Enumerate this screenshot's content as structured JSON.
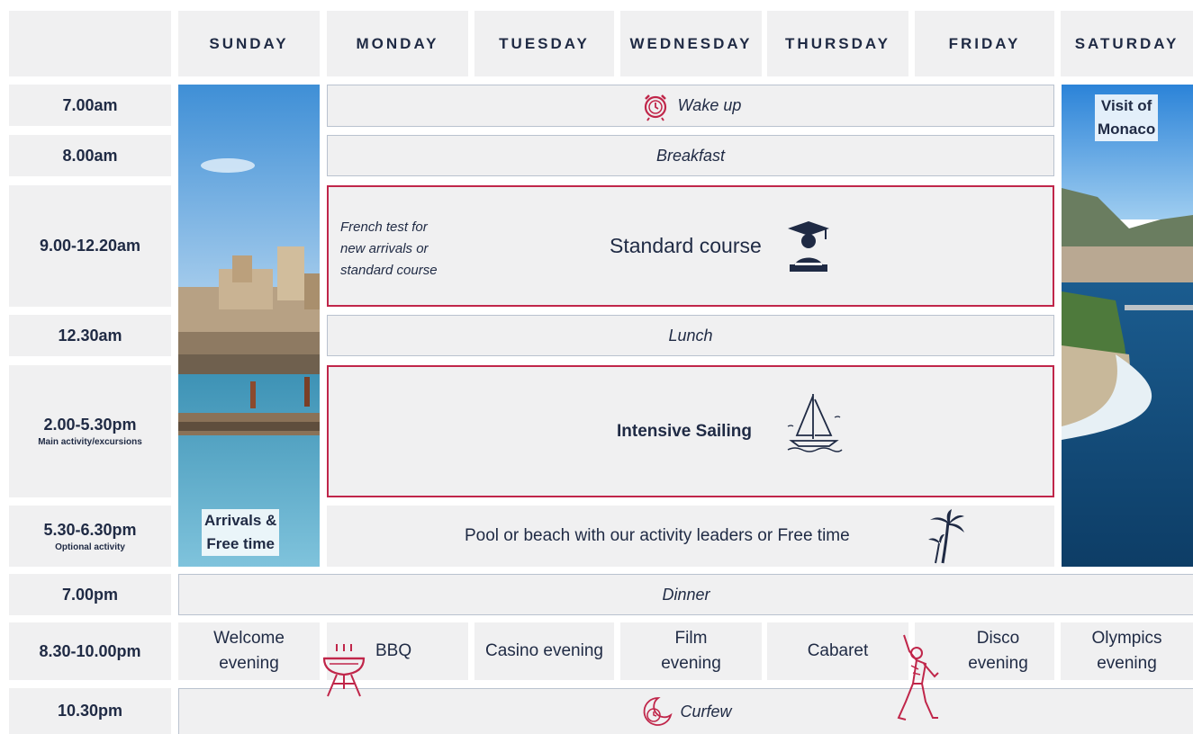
{
  "days": [
    "SUNDAY",
    "MONDAY",
    "TUESDAY",
    "WEDNESDAY",
    "THURSDAY",
    "FRIDAY",
    "SATURDAY"
  ],
  "times": [
    {
      "time": "7.00am",
      "sub": ""
    },
    {
      "time": "8.00am",
      "sub": ""
    },
    {
      "time": "9.00-12.20am",
      "sub": ""
    },
    {
      "time": "12.30am",
      "sub": ""
    },
    {
      "time": "2.00-5.30pm",
      "sub": "Main activity/excursions"
    },
    {
      "time": "5.30-6.30pm",
      "sub": "Optional activity"
    },
    {
      "time": "7.00pm",
      "sub": ""
    },
    {
      "time": "8.30-10.00pm",
      "sub": ""
    },
    {
      "time": "10.30pm",
      "sub": ""
    }
  ],
  "weekday_blocks": {
    "wake_up": "Wake up",
    "breakfast": "Breakfast",
    "french_test": [
      "French test for",
      "new arrivals or",
      "standard course"
    ],
    "standard_course": "Standard course",
    "lunch": "Lunch",
    "intensive_sailing": "Intensive Sailing",
    "pool": "Pool or beach with our activity leaders or Free time"
  },
  "sunday_label": [
    "Arrivals &",
    "Free time"
  ],
  "saturday_label": [
    "Visit of",
    "Monaco"
  ],
  "dinner": "Dinner",
  "evenings": [
    [
      "Welcome",
      "evening"
    ],
    [
      "BBQ"
    ],
    [
      "Casino evening"
    ],
    [
      "Film",
      "evening"
    ],
    [
      "Cabaret"
    ],
    [
      "Disco",
      "evening"
    ],
    [
      "Olympics",
      "evening"
    ]
  ],
  "curfew": "Curfew",
  "icons": [
    "alarm-clock-icon",
    "graduate-icon",
    "sailboat-icon",
    "palm-tree-icon",
    "bbq-grill-icon",
    "disco-dancer-icon",
    "moon-clock-icon"
  ],
  "colors": {
    "accent_red": "#c0264a",
    "navy": "#1f2a44",
    "cell_bg": "#f0f0f1",
    "border": "#b9c2cf"
  }
}
